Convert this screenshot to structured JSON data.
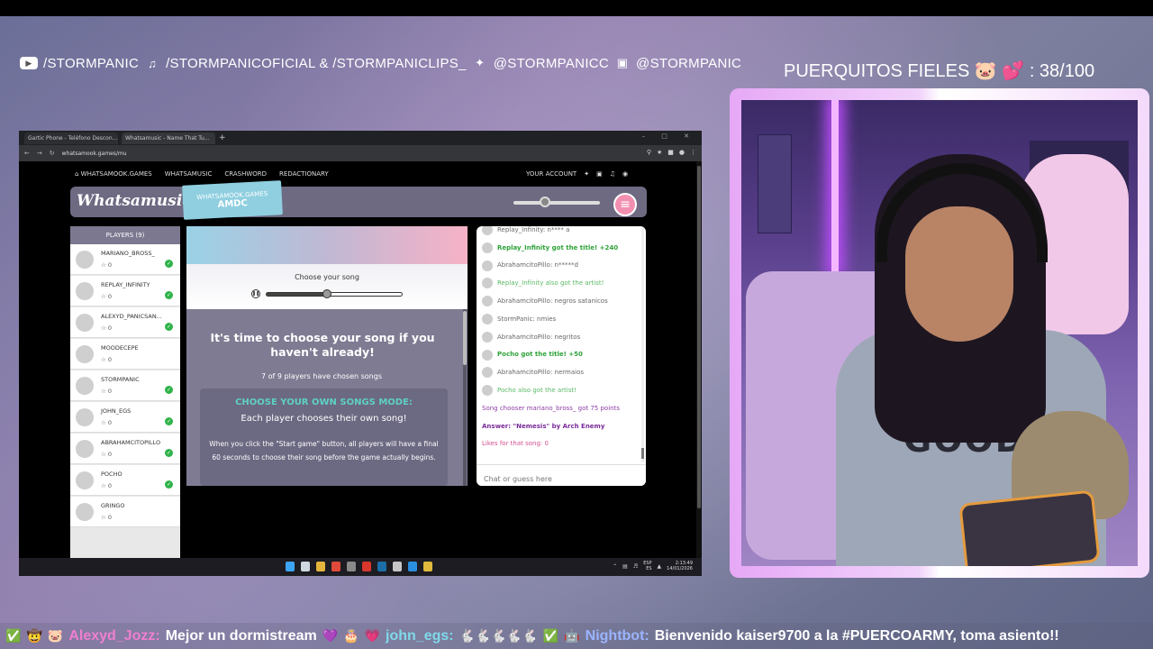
{
  "overlay": {
    "social": {
      "youtube": "/STORMPANIC",
      "tiktok": "/STORMPANICOFICIAL & /STORMPANICLIPS_",
      "twitter": "@STORMPANICC",
      "instagram": "@STORMPANIC"
    },
    "goal": "PUERQUITOS FIELES 🐷 💕 : 38/100"
  },
  "browser": {
    "tabs": [
      {
        "label": "Gartic Phone - Teléfono Descon..."
      },
      {
        "label": "Whatsamusic - Name That Tu..."
      }
    ],
    "new_tab": "+",
    "url": "whatsamook.games/mu",
    "window_controls": "– □ ✕"
  },
  "site": {
    "nav": [
      "WHATSAMOOK.GAMES",
      "WHATSAMUSIC",
      "CRASHWORD",
      "REDACTIONARY"
    ],
    "your_account": "YOUR ACCOUNT",
    "logo": "Whatsamusic",
    "room_card": {
      "label": "WHATSAMOOK.GAMES",
      "code": "AMDC"
    },
    "volume": 0.35,
    "menu_icon": "≡"
  },
  "players": {
    "header": "PLAYERS (9)",
    "list": [
      {
        "name": "MARIANO_BROSS_",
        "score": "0",
        "ready": true
      },
      {
        "name": "REPLAY_INFINITY",
        "score": "0",
        "ready": true
      },
      {
        "name": "ALEXYD_PANICSAN...",
        "score": "0",
        "ready": true
      },
      {
        "name": "MOODECEPE",
        "score": "0",
        "ready": false
      },
      {
        "name": "STORMPANIC",
        "score": "0",
        "ready": true
      },
      {
        "name": "JOHN_EGS",
        "score": "0",
        "ready": true
      },
      {
        "name": "ABRAHAMCITOPILLO",
        "score": "0",
        "ready": true
      },
      {
        "name": "POCHO",
        "score": "0",
        "ready": true
      },
      {
        "name": "GRINGO",
        "score": "0",
        "ready": false
      }
    ]
  },
  "main": {
    "choose_label": "Choose your song",
    "progress": 0.45,
    "title": "It's time to choose your song if you haven't already!",
    "subtitle": "7 of 9 players have chosen songs",
    "mode_title": "CHOOSE YOUR OWN SONGS MODE:",
    "mode_sub": "Each player chooses their own song!",
    "mode_body": "When you click the \"Start game\" button, all players will have a final 60 seconds to choose their song before the game actually begins."
  },
  "chat": {
    "messages": [
      {
        "text": "Replay_Infinity: n**** a",
        "style": ""
      },
      {
        "text": "Replay_Infinity got the title! +240",
        "style": "green"
      },
      {
        "text": "AbrahamcitoPillo: n*****d",
        "style": ""
      },
      {
        "text": "Replay_Infinity also got the artist!",
        "style": "lightgreen"
      },
      {
        "text": "AbrahamcitoPillo: negros satanicos",
        "style": ""
      },
      {
        "text": "StormPanic: nmies",
        "style": ""
      },
      {
        "text": "AbrahamcitoPillo: negritos",
        "style": ""
      },
      {
        "text": "Pocho got the title! +50",
        "style": "green"
      },
      {
        "text": "AbrahamcitoPillo: nermaios",
        "style": ""
      },
      {
        "text": "Pocho also got the artist!",
        "style": "lightgreen"
      },
      {
        "text": "Song chooser mariano_bross_ got 75 points",
        "style": "purple"
      },
      {
        "text": "Answer: \"Nemesis\" by Arch Enemy",
        "style": "purple-b"
      },
      {
        "text": "Likes for that song: 0",
        "style": "pink"
      }
    ],
    "input_placeholder": "Chat or guess here"
  },
  "taskbar": {
    "lang": "ESP\nES",
    "time": "2:13:49",
    "date": "14/01/2026"
  },
  "ticker": {
    "user1": "Alexyd_Jozz:",
    "msg1": "Mejor un dormistream",
    "user2": "john_egs:",
    "user3": "Nightbot:",
    "msg3": "Bienvenido kaiser9700 a la #PUERCOARMY, toma asiento!!"
  },
  "colors": {
    "accent_pink": "#f28fb0",
    "card_blue": "#8fcfe0",
    "mode_title": "#5ed0c4",
    "chat_green": "#2ea23a",
    "ready_green": "#2fb34a"
  }
}
